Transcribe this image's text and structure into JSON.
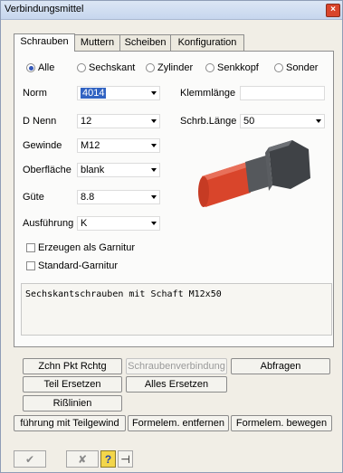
{
  "window": {
    "title": "Verbindungsmittel"
  },
  "tabs": [
    {
      "label": "Schrauben",
      "active": true
    },
    {
      "label": "Muttern",
      "active": false
    },
    {
      "label": "Scheiben",
      "active": false
    },
    {
      "label": "Konfiguration",
      "active": false
    }
  ],
  "radios": [
    {
      "label": "Alle",
      "selected": true
    },
    {
      "label": "Sechskant",
      "selected": false
    },
    {
      "label": "Zylinder",
      "selected": false
    },
    {
      "label": "Senkkopf",
      "selected": false
    },
    {
      "label": "Sonder",
      "selected": false
    }
  ],
  "fields": {
    "norm": {
      "label": "Norm",
      "value": "4014"
    },
    "dnenn": {
      "label": "D Nenn",
      "value": "12"
    },
    "gewinde": {
      "label": "Gewinde",
      "value": "M12"
    },
    "oberflaeche": {
      "label": "Oberfläche",
      "value": "blank"
    },
    "guete": {
      "label": "Güte",
      "value": "8.8"
    },
    "ausfuehrung": {
      "label": "Ausführung",
      "value": "K"
    },
    "klemmlaenge": {
      "label": "Klemmlänge",
      "value": ""
    },
    "schrblaenge": {
      "label": "Schrb.Länge",
      "value": "50"
    }
  },
  "checkboxes": [
    {
      "label": "Erzeugen als Garnitur",
      "checked": false
    },
    {
      "label": "Standard-Garnitur",
      "checked": false
    }
  ],
  "description": "Sechskantschrauben mit Schaft M12x50",
  "buttons": {
    "zchn": "Zchn Pkt Rchtg",
    "schraubenverbindung": "Schraubenverbindung",
    "abfragen": "Abfragen",
    "teil_ersetzen": "Teil Ersetzen",
    "alles_ersetzen": "Alles Ersetzen",
    "risslinien": "Rißlinien",
    "fuehrung": "führung mit Teilgewind",
    "entfernen": "Formelem. entfernen",
    "bewegen": "Formelem. bewegen"
  },
  "colors": {
    "accent": "#3163c2",
    "bolt_head": "#4f5256",
    "bolt_thread": "#d9452b"
  }
}
